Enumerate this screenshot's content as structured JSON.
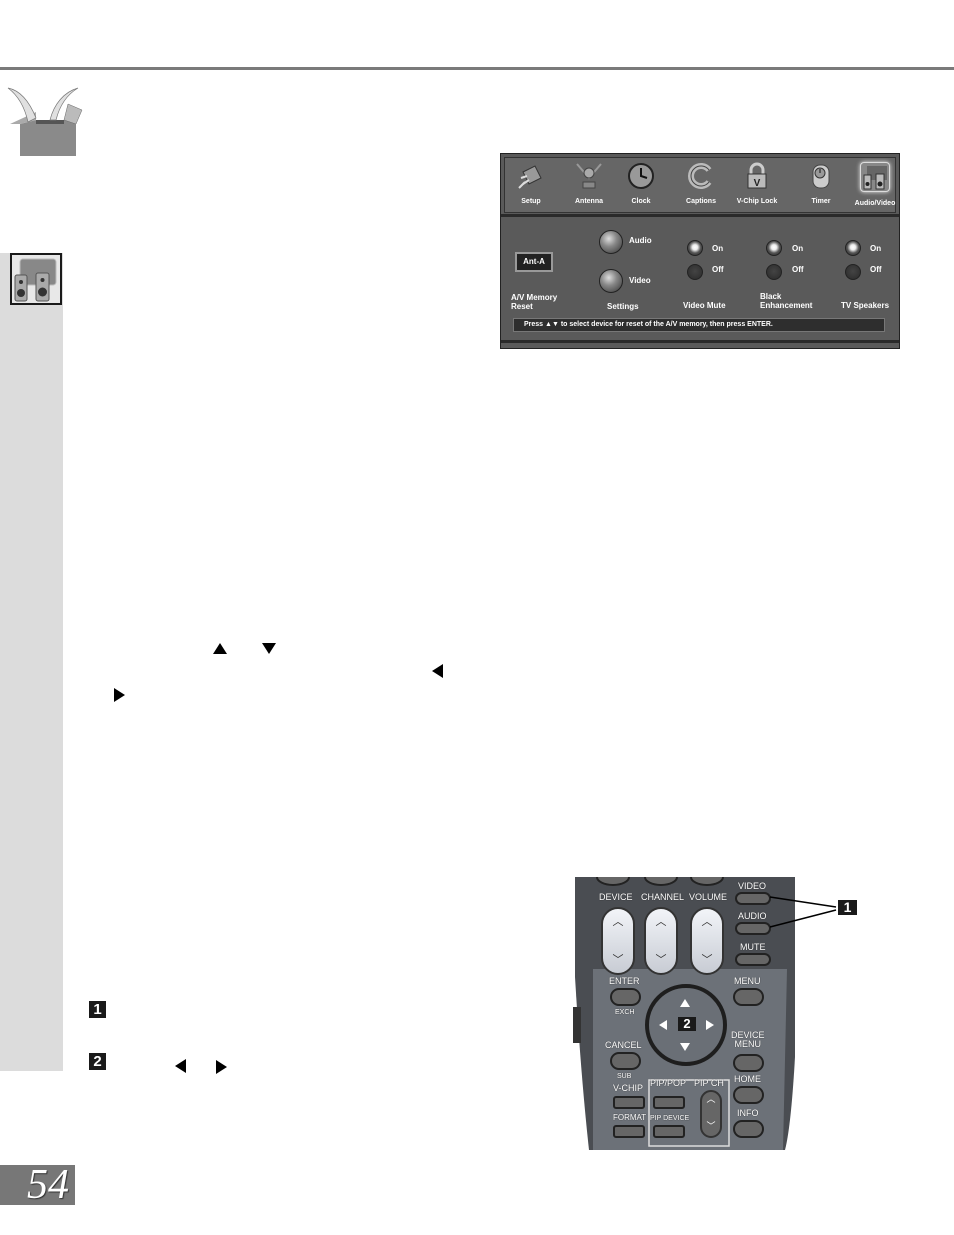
{
  "page": {
    "page_number": "54"
  },
  "icons": {
    "header_icon": "open-box-icon",
    "section_icon": "audio-video-speakers-icon"
  },
  "osd_menu": {
    "tabs": [
      {
        "label": "Setup",
        "icon": "plug-icon"
      },
      {
        "label": "Antenna",
        "icon": "antenna-icon"
      },
      {
        "label": "Clock",
        "icon": "clock-icon"
      },
      {
        "label": "Captions",
        "icon": "captions-icon"
      },
      {
        "label": "V-Chip Lock",
        "icon": "lock-icon"
      },
      {
        "label": "Timer",
        "icon": "timer-icon"
      },
      {
        "label": "Audio/Video",
        "icon": "speakers-icon",
        "active": true
      }
    ],
    "av_memory_reset": {
      "value": "Ant-A",
      "label_line1": "A/V Memory",
      "label_line2": "Reset"
    },
    "settings": {
      "audio_label": "Audio",
      "video_label": "Video",
      "label": "Settings"
    },
    "video_mute": {
      "on_label": "On",
      "off_label": "Off",
      "selected": "On",
      "label": "Video Mute"
    },
    "black_enhancement": {
      "on_label": "On",
      "off_label": "Off",
      "selected": "On",
      "label_line1": "Black",
      "label_line2": "Enhancement"
    },
    "tv_speakers": {
      "on_label": "On",
      "off_label": "Off",
      "selected": "On",
      "label": "TV Speakers"
    },
    "status_text": "Press ▲▼ to select device for reset of the A/V memory, then press ENTER."
  },
  "remote": {
    "rockers": [
      {
        "label": "DEVICE"
      },
      {
        "label": "CHANNEL"
      },
      {
        "label": "VOLUME"
      }
    ],
    "rocker_up": "︿",
    "rocker_down": "﹀",
    "video": "VIDEO",
    "audio": "AUDIO",
    "mute": "MUTE",
    "enter": "ENTER",
    "exch": "EXCH",
    "menu": "MENU",
    "cancel": "CANCEL",
    "sub": "SUB",
    "device_menu_line1": "DEVICE",
    "device_menu_line2": "MENU",
    "vchip": "V-CHIP",
    "pip_pop": "PIP/POP",
    "pip_ch": "PIP CH",
    "home": "HOME",
    "format": "FORMAT",
    "pip_device": "PIP DEVICE",
    "info": "INFO",
    "dpad_badge": "2"
  },
  "callouts": {
    "step1": "1",
    "step2": "2"
  }
}
